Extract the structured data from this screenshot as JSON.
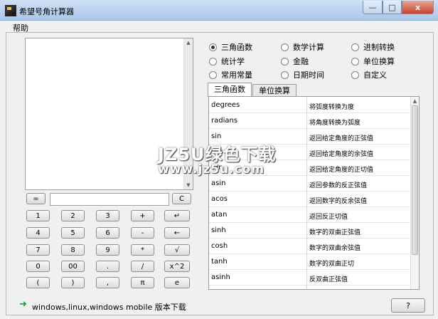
{
  "window": {
    "title": "希望号角计算器",
    "min": "—",
    "max": "□",
    "close": "x"
  },
  "menu": {
    "help": "帮助"
  },
  "calc": {
    "equals": "=",
    "clear": "C",
    "keys": [
      [
        "1",
        "2",
        "3",
        "+",
        "↵"
      ],
      [
        "4",
        "5",
        "6",
        "-",
        "←"
      ],
      [
        "7",
        "8",
        "9",
        "*",
        "√"
      ],
      [
        "0",
        "00",
        ".",
        "/",
        "x^2"
      ],
      [
        "(",
        ")",
        ",",
        "π",
        "e"
      ]
    ]
  },
  "categories": [
    {
      "label": "三角函数",
      "selected": true
    },
    {
      "label": "数学计算",
      "selected": false
    },
    {
      "label": "进制转换",
      "selected": false
    },
    {
      "label": "统计学",
      "selected": false
    },
    {
      "label": "金融",
      "selected": false
    },
    {
      "label": "单位换算",
      "selected": false
    },
    {
      "label": "常用常量",
      "selected": false
    },
    {
      "label": "日期时间",
      "selected": false
    },
    {
      "label": "自定义",
      "selected": false
    }
  ],
  "tabs": [
    "三角函数",
    "单位换算"
  ],
  "functions": [
    {
      "name": "degrees",
      "desc": "将弧度转换为度"
    },
    {
      "name": "radians",
      "desc": "将角度转换为弧度"
    },
    {
      "name": "sin",
      "desc": "返回给定角度的正弦值"
    },
    {
      "name": "cos",
      "desc": "返回给定角度的余弦值"
    },
    {
      "name": "tan",
      "desc": "返回给定角度的正切值"
    },
    {
      "name": "asin",
      "desc": "返回参数的反正弦值"
    },
    {
      "name": "acos",
      "desc": "返回数字的反余弦值"
    },
    {
      "name": "atan",
      "desc": "返回反正切值"
    },
    {
      "name": "sinh",
      "desc": "数字的双曲正弦值"
    },
    {
      "name": "cosh",
      "desc": "数字的双曲余弦值"
    },
    {
      "name": "tanh",
      "desc": "数字的双曲正切"
    },
    {
      "name": "asinh",
      "desc": "反双曲正弦值"
    }
  ],
  "status": {
    "text": "windows,linux,windows mobile 版本下载",
    "icon": "green-arrow-icon"
  },
  "help_button": "?",
  "watermark": {
    "line1": "JZ5U绿色下载",
    "line2": "www.jz5u.com"
  },
  "colors": {
    "titlebar": "#b9d1ee",
    "accent_arrow": "#1f9a3a"
  }
}
